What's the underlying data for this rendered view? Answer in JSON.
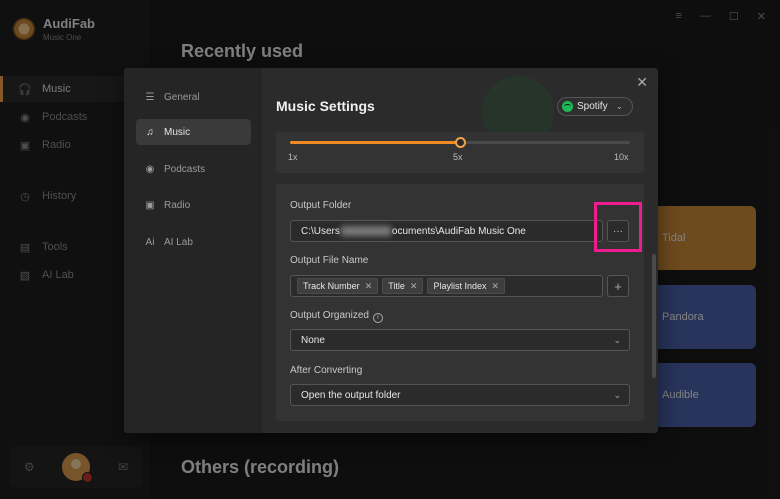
{
  "app": {
    "name": "AudiFab",
    "subtitle": "Music One"
  },
  "sidebar": {
    "items": [
      {
        "label": "Music",
        "icon": "headphones-icon",
        "active": true
      },
      {
        "label": "Podcasts",
        "icon": "podcast-icon"
      },
      {
        "label": "Radio",
        "icon": "radio-icon"
      },
      {
        "label": "History",
        "icon": "clock-icon"
      },
      {
        "label": "Tools",
        "icon": "toolbox-icon"
      },
      {
        "label": "AI Lab",
        "icon": "ai-icon"
      }
    ]
  },
  "main": {
    "recent_title": "Recently used",
    "others_title": "Others (recording)",
    "services": [
      {
        "label": "Tidal",
        "color": "#c8893a"
      },
      {
        "label": "Pandora",
        "color": "#4a5fa8"
      },
      {
        "label": "Audible",
        "color": "#4a5fa8"
      }
    ]
  },
  "modal": {
    "title": "Music Settings",
    "nav": [
      {
        "label": "General",
        "icon": "sliders-icon"
      },
      {
        "label": "Music",
        "icon": "music-note-icon",
        "active": true
      },
      {
        "label": "Podcasts",
        "icon": "podcast-icon"
      },
      {
        "label": "Radio",
        "icon": "radio-icon"
      },
      {
        "label": "AI Lab",
        "icon": "ai-icon"
      }
    ],
    "source": {
      "selected": "Spotify"
    },
    "speed": {
      "ticks": [
        "1x",
        "5x",
        "10x"
      ],
      "value_fraction": 0.5,
      "accent": "#f08a24"
    },
    "output_folder": {
      "label": "Output Folder",
      "prefix": "C:\\Users",
      "suffix": "ocuments\\AudiFab Music One",
      "browse_label": "···"
    },
    "output_file_name": {
      "label": "Output File Name",
      "tags": [
        "Track Number",
        "Title",
        "Playlist Index"
      ],
      "add_label": "+"
    },
    "output_organized": {
      "label": "Output Organized",
      "value": "None"
    },
    "after_converting": {
      "label": "After Converting",
      "value": "Open the output folder"
    },
    "highlight_color": "#ee1c8f"
  }
}
